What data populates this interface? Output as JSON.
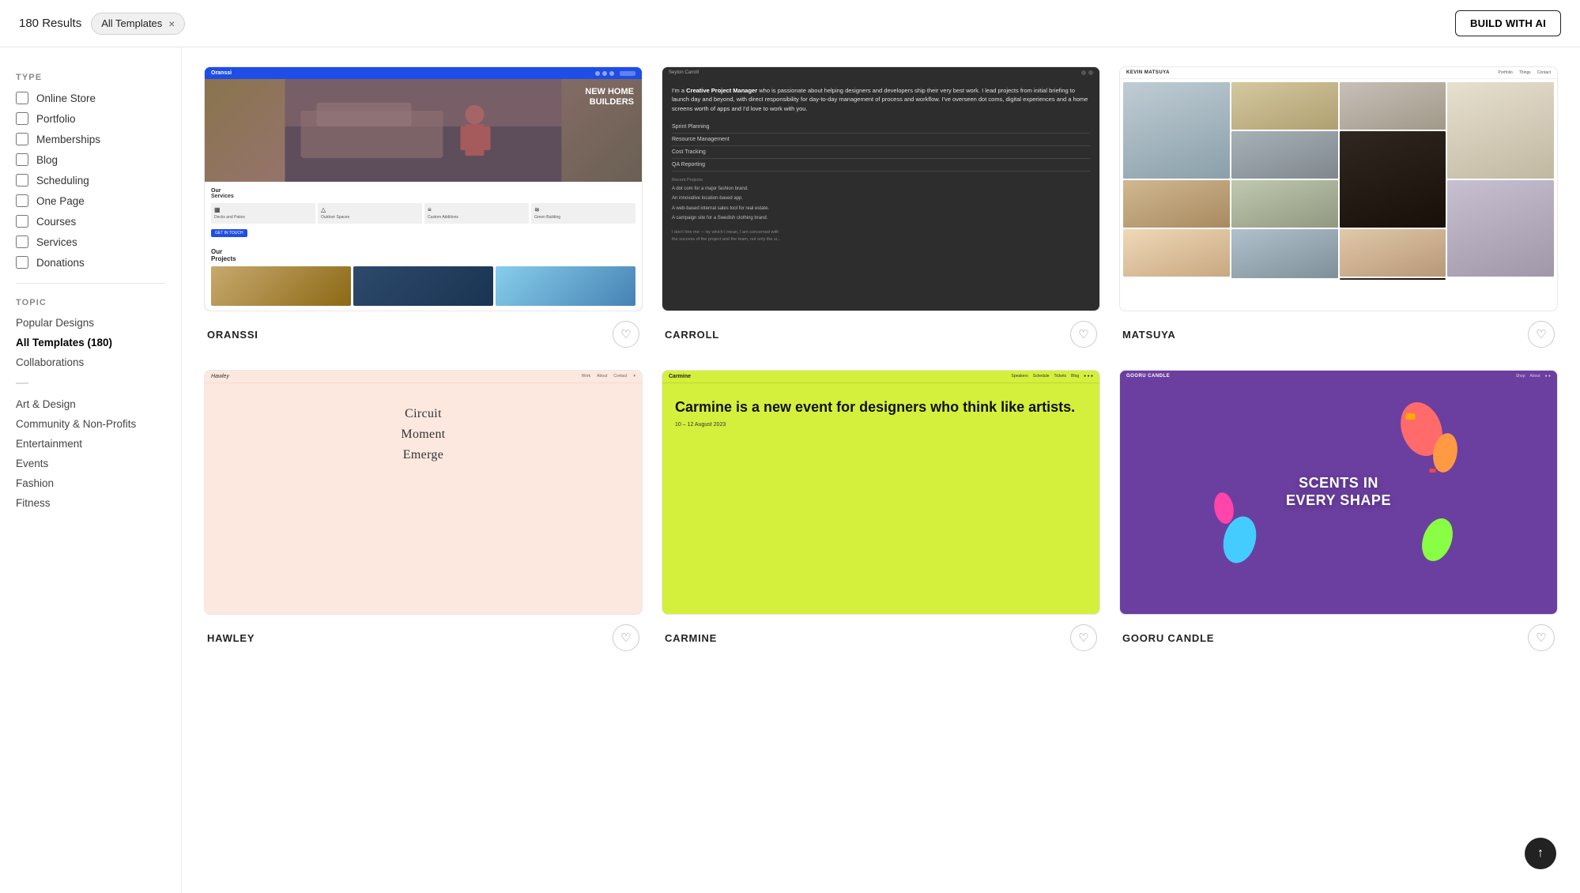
{
  "header": {
    "results_count": "180 Results",
    "filter_tag": "All Templates",
    "filter_close": "×",
    "build_ai_label": "BUILD WITH AI"
  },
  "sidebar": {
    "type_section_title": "TYPE",
    "type_filters": [
      {
        "id": "online-store",
        "label": "Online Store",
        "checked": false
      },
      {
        "id": "portfolio",
        "label": "Portfolio",
        "checked": false
      },
      {
        "id": "memberships",
        "label": "Memberships",
        "checked": false
      },
      {
        "id": "blog",
        "label": "Blog",
        "checked": false
      },
      {
        "id": "scheduling",
        "label": "Scheduling",
        "checked": false
      },
      {
        "id": "one-page",
        "label": "One Page",
        "checked": false
      },
      {
        "id": "courses",
        "label": "Courses",
        "checked": false
      },
      {
        "id": "services",
        "label": "Services",
        "checked": false
      },
      {
        "id": "donations",
        "label": "Donations",
        "checked": false
      }
    ],
    "topic_section_title": "TOPIC",
    "topic_links": [
      {
        "id": "popular-designs",
        "label": "Popular Designs",
        "active": false
      },
      {
        "id": "all-templates",
        "label": "All Templates (180)",
        "active": true
      },
      {
        "id": "collaborations",
        "label": "Collaborations",
        "active": false
      },
      {
        "id": "separator",
        "label": "—",
        "is_separator": true
      },
      {
        "id": "art-design",
        "label": "Art & Design",
        "active": false
      },
      {
        "id": "community",
        "label": "Community & Non-Profits",
        "active": false
      },
      {
        "id": "entertainment",
        "label": "Entertainment",
        "active": false
      },
      {
        "id": "events",
        "label": "Events",
        "active": false
      },
      {
        "id": "fashion",
        "label": "Fashion",
        "active": false
      },
      {
        "id": "fitness",
        "label": "Fitness",
        "active": false
      }
    ]
  },
  "templates": [
    {
      "id": "oranssi",
      "name": "ORANSSI",
      "type": "oranssi"
    },
    {
      "id": "carroll",
      "name": "CARROLL",
      "type": "carroll"
    },
    {
      "id": "matsuya",
      "name": "MATSUYA",
      "type": "matsuya"
    },
    {
      "id": "hawley",
      "name": "HAWLEY",
      "type": "hawley"
    },
    {
      "id": "carmine",
      "name": "CARMINE",
      "type": "carmine"
    },
    {
      "id": "gooru",
      "name": "GOORU CANDLE",
      "type": "gooru"
    }
  ],
  "oranssi": {
    "logo": "Oranssi",
    "hero_text": "NEW HOME\nBUILDERS",
    "services_title": "Our",
    "services_subtitle": "Services",
    "service_items": [
      {
        "icon": "▦",
        "name": "Decks and Patios"
      },
      {
        "icon": "△",
        "name": "Outdoor Spaces"
      },
      {
        "icon": "≡",
        "name": "Custom Additions"
      },
      {
        "icon": "≋",
        "name": "Green Building"
      }
    ],
    "projects_title": "Our\nProjects"
  },
  "carroll": {
    "logo": "Seyton Carroll",
    "intro": "I'm a Creative Project Manager who is passionate about helping designers and developers ship their very best work. I lead projects from initial briefing to launch day and beyond, with direct responsibility for day-to-day management of process and workflow. I've overseen dot coms, digital experiences and a home screens worth of apps and I'd love to work with you.",
    "skills": [
      "Sprint Planning",
      "Resource Management",
      "Cost Tracking",
      "QA Reporting"
    ],
    "project_label": "Recent Projects",
    "projects": [
      "A dot com for a major fashion brand.",
      "An innovative location-based app.",
      "A web-based internal sales tool for real estate.",
      "A campaign site for a Swedish clothing brand."
    ],
    "footer_note": "I don't hire me — by which I mean, I am concerned with the success of the project and the team, not only the si..."
  },
  "matsuya": {
    "logo": "KEVIN MATSUYA",
    "nav_items": [
      "Portfolio",
      "Things",
      "Contact"
    ]
  },
  "hawley": {
    "logo": "Hawley",
    "nav_items": [
      "Work",
      "About",
      "Contact"
    ],
    "text_lines": [
      "Circuit",
      "Moment",
      "Emerge"
    ]
  },
  "carmine": {
    "logo": "Carmine",
    "nav_items": [
      "Speakers",
      "Schedule",
      "Tickets",
      "Blog"
    ],
    "heading": "Carmine is a new event for designers who think like artists.",
    "date": "10 – 12 August 2023"
  },
  "gooru": {
    "logo": "GOORU CANDLE",
    "hero_text": "SCENTS IN EVERY SHAPE"
  }
}
